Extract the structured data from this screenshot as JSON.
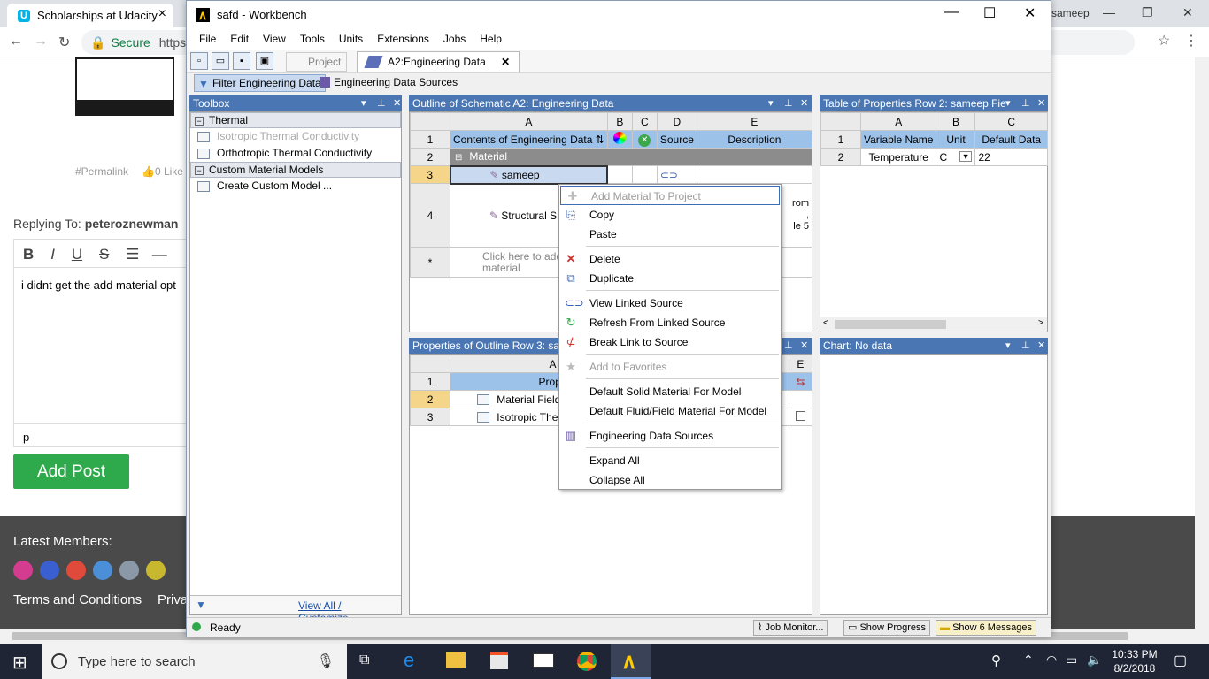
{
  "browser": {
    "tab_title": "Scholarships at Udacity",
    "secure_label": "Secure",
    "url_partial": "https",
    "profile_name": "sameep"
  },
  "forum": {
    "permalink": "#Permalink",
    "like_text": "0 Like",
    "replying_label": "Replying To:",
    "replying_name": "peteroznewman",
    "editor_text": "i didnt get the add material opt",
    "editor_status": "p",
    "add_post": "Add Post",
    "latest_members": "Latest Members:",
    "terms": "Terms and Conditions",
    "privacy": "Priva"
  },
  "workbench": {
    "title": "safd - Workbench",
    "menu": [
      "File",
      "Edit",
      "View",
      "Tools",
      "Units",
      "Extensions",
      "Jobs",
      "Help"
    ],
    "tabs": {
      "project": "Project",
      "engdata": "A2:Engineering Data"
    },
    "filter_btn": "Filter Engineering Data",
    "sources_btn": "Engineering Data Sources",
    "toolbox": {
      "title": "Toolbox",
      "group_thermal": "Thermal",
      "item_iso": "Isotropic Thermal Conductivity",
      "item_ortho": "Orthotropic Thermal Conductivity",
      "group_custom": "Custom Material Models",
      "item_create": "Create Custom Model ...",
      "view_all": "View All / Customize..."
    },
    "outline": {
      "title": "Outline of Schematic A2: Engineering Data",
      "cols": [
        "A",
        "B",
        "C",
        "D",
        "E"
      ],
      "hdr_contents": "Contents of Engineering Data",
      "hdr_source": "Source",
      "hdr_desc": "Description",
      "material": "Material",
      "row3": "sameep",
      "row4": "Structural S",
      "row4_desc1": "rom",
      "row4_desc2": ",",
      "row4_desc3": "le 5",
      "add_hint1": "Click here to add a",
      "add_hint2": "material",
      "rows": [
        "1",
        "2",
        "3",
        "4",
        "*"
      ]
    },
    "table_props": {
      "title": "Table of Properties Row 2: sameep Fie",
      "cols": [
        "A",
        "B",
        "C"
      ],
      "h_var": "Variable Name",
      "h_unit": "Unit",
      "h_default": "Default Data",
      "var": "Temperature",
      "unit": "C",
      "default": "22",
      "rows": [
        "1",
        "2"
      ]
    },
    "props_outline": {
      "title": "Properties of Outline Row 3: sam",
      "col_a": "A",
      "col_e": "E",
      "hdr": "Prope",
      "r2": "Material Field V",
      "r3": "Isotropic Therm",
      "rows": [
        "1",
        "2",
        "3"
      ]
    },
    "chart": {
      "title": "Chart: No data"
    },
    "status": {
      "ready": "Ready",
      "job_monitor": "Job Monitor...",
      "show_progress": "Show Progress",
      "show_messages": "Show 6 Messages"
    }
  },
  "context_menu": {
    "add_material": "Add Material To Project",
    "copy": "Copy",
    "paste": "Paste",
    "delete": "Delete",
    "duplicate": "Duplicate",
    "view_linked": "View Linked Source",
    "refresh_linked": "Refresh From Linked Source",
    "break_link": "Break Link to Source",
    "add_fav": "Add to Favorites",
    "default_solid": "Default Solid Material For Model",
    "default_fluid": "Default Fluid/Field Material For Model",
    "eng_sources": "Engineering Data Sources",
    "expand": "Expand All",
    "collapse": "Collapse All"
  },
  "taskbar": {
    "search_placeholder": "Type here to search",
    "time": "10:33 PM",
    "date": "8/2/2018"
  },
  "colors": {
    "panel_header": "#4a77b4",
    "udacity": "#02b3e4",
    "add_post": "#2eaa4c"
  }
}
